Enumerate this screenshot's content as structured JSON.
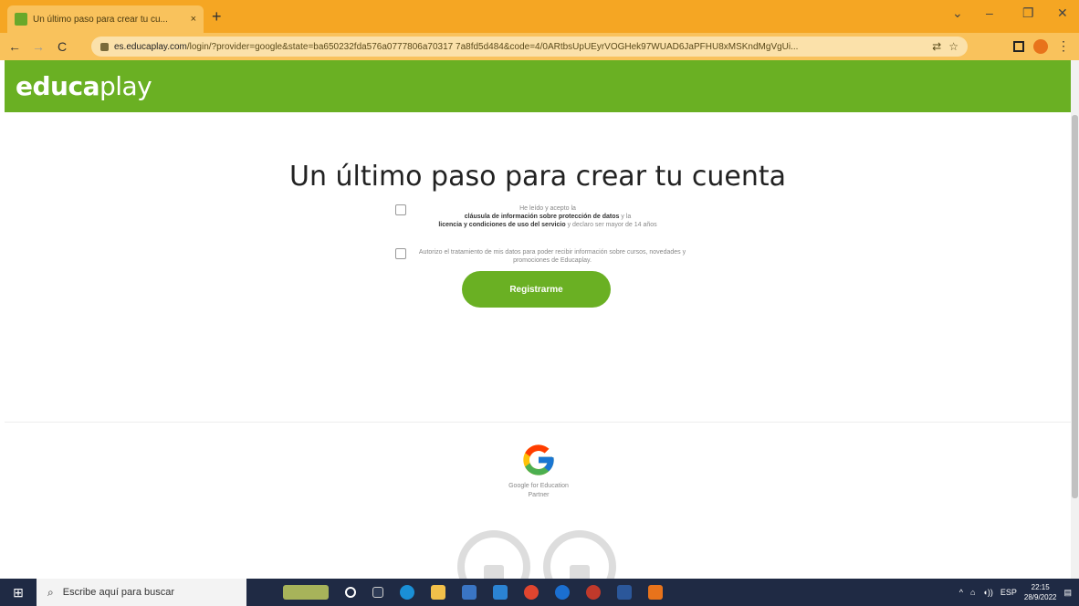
{
  "browser": {
    "tab_title": "Un último paso para crear tu cu...",
    "tab_close": "×",
    "new_tab": "+",
    "url_host": "es.educaplay.com",
    "url_path": "/login/?provider=google&state=ba650232fda576a0777806a70317 7a8fd5d484&code=4/0ARtbsUpUEyrVOGHek97WUAD6JaPFHU8xMSKndMgVgUi...",
    "win_minimize": "–",
    "win_maximize": "❐",
    "win_close": "✕",
    "win_chevron": "⌄"
  },
  "site": {
    "logo_main": "educa",
    "logo_play": "play"
  },
  "page": {
    "heading": "Un último paso para crear tu cuenta",
    "consent1_pre": "He leído y acepto la",
    "consent1_bold1": "cláusula de información sobre protección de datos",
    "consent1_mid": "y la",
    "consent1_bold2": "licencia y condiciones de uso del servicio",
    "consent1_post": "y declaro ser mayor de 14 años",
    "consent2": "Autorizo el tratamiento de mis datos para poder recibir información sobre cursos, novedades y promociones de Educaplay.",
    "register_button": "Registrarme",
    "google_text": "Google for Education",
    "google_partner": "Partner"
  },
  "taskbar": {
    "search_placeholder": "Escribe aquí para buscar",
    "lang": "ESP",
    "time": "22:15",
    "date": "28/9/2022"
  },
  "colors": {
    "brand_green": "#6ab023",
    "chrome_orange": "#f5a623",
    "taskbar": "#1f2a44"
  }
}
